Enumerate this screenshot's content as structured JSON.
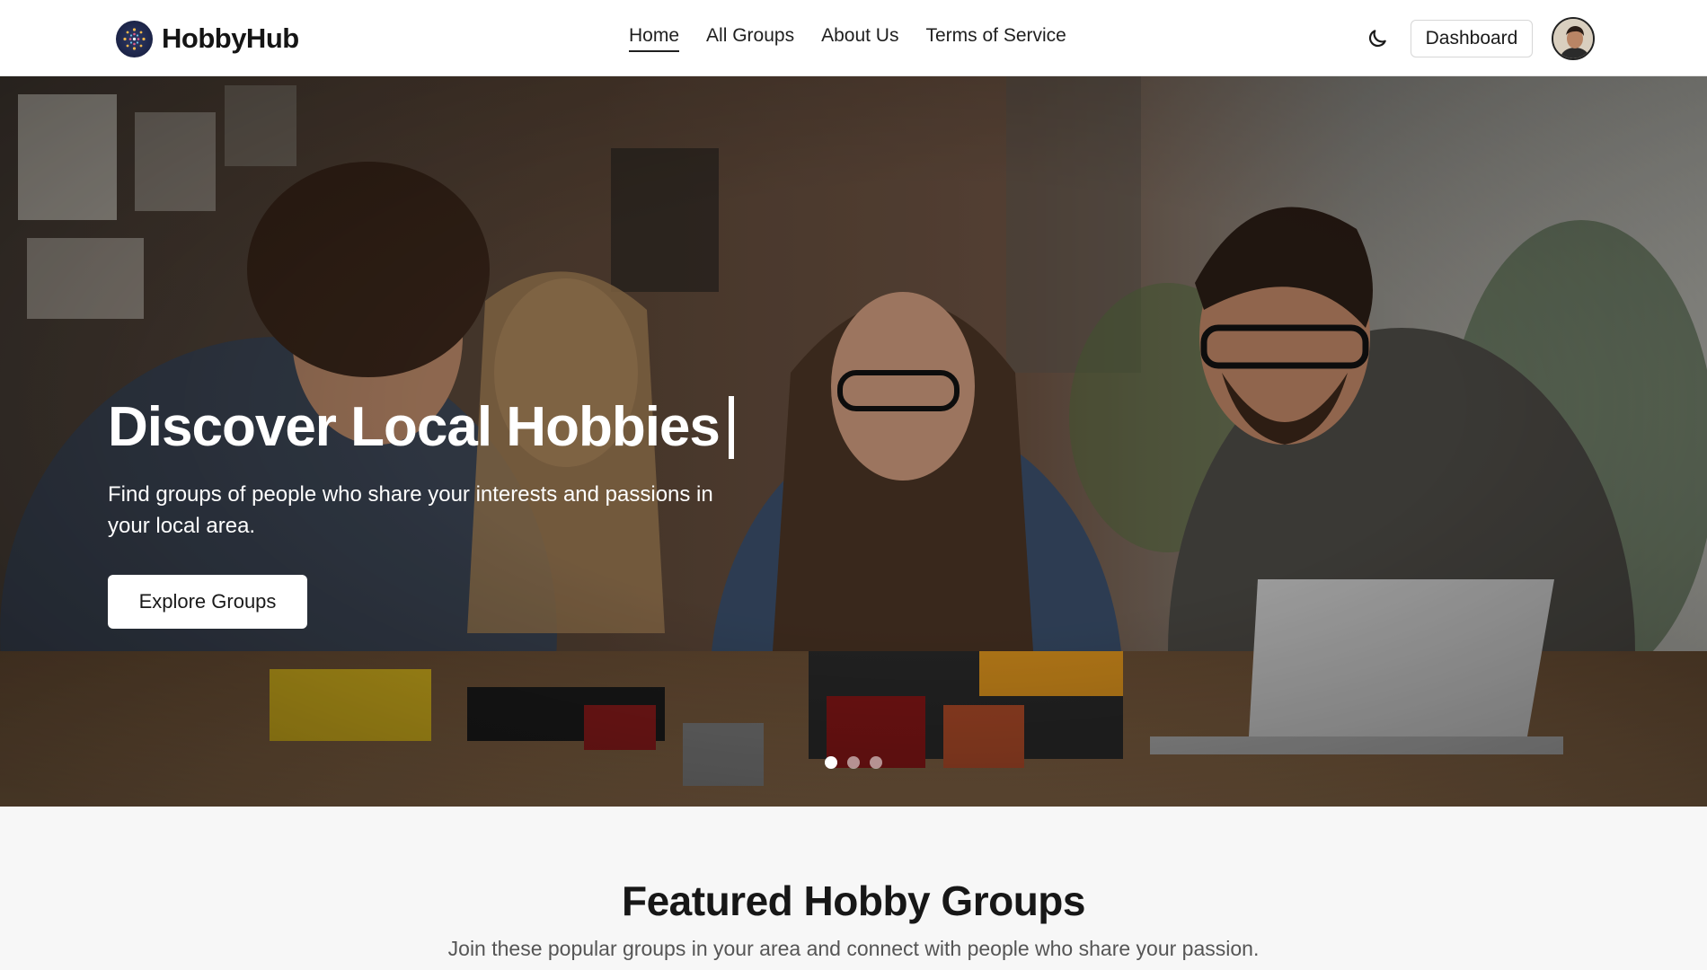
{
  "brand": {
    "name": "HobbyHub",
    "logo_icon": "globe-dots-icon"
  },
  "nav": {
    "items": [
      {
        "label": "Home",
        "active": true
      },
      {
        "label": "All Groups",
        "active": false
      },
      {
        "label": "About Us",
        "active": false
      },
      {
        "label": "Terms of Service",
        "active": false
      }
    ]
  },
  "header_actions": {
    "theme_toggle_icon": "moon-icon",
    "dashboard_label": "Dashboard",
    "avatar_icon": "user-avatar"
  },
  "hero": {
    "title": "Discover Local Hobbies",
    "subtitle": "Find groups of people who share your interests and passions in your local area.",
    "cta_label": "Explore Groups",
    "slides_total": 3,
    "active_slide": 1
  },
  "featured": {
    "title": "Featured Hobby Groups",
    "subtitle": "Join these popular groups in your area and connect with people who share your passion."
  },
  "colors": {
    "header_bg": "#ffffff",
    "page_bg": "#f7f7f7",
    "hero_text": "#ffffff",
    "text_primary": "#1a1a1a",
    "text_muted": "#555555"
  }
}
